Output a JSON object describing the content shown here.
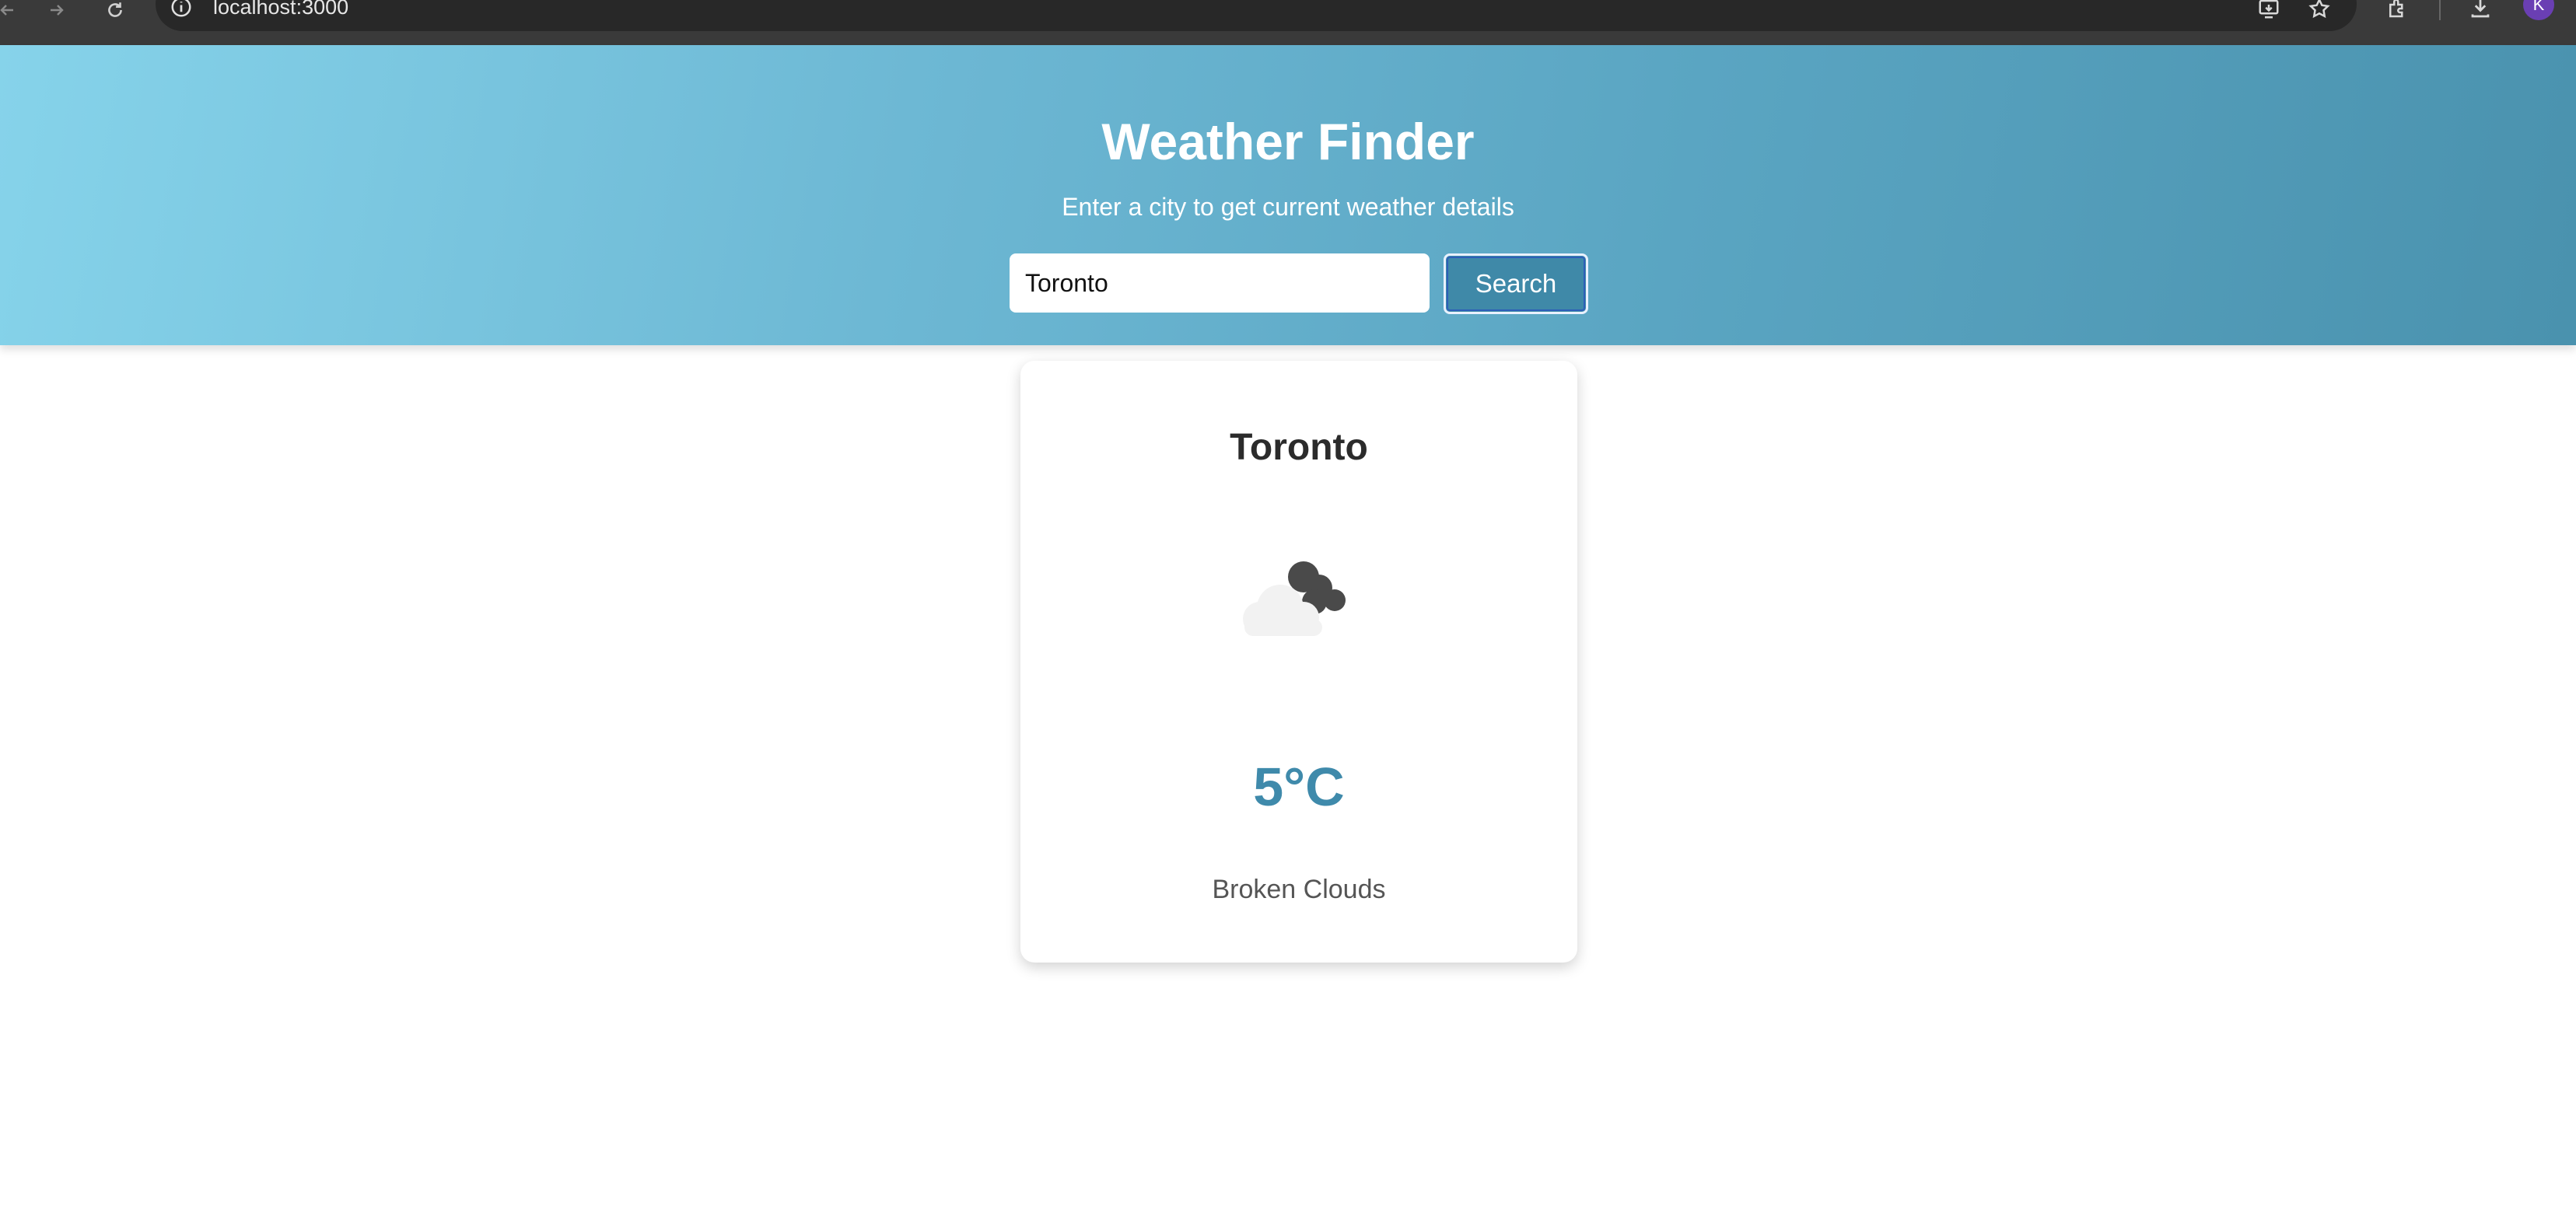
{
  "browser": {
    "url": "localhost:3000",
    "avatar_initial": "K",
    "icons": [
      "back-arrow-icon",
      "forward-arrow-icon",
      "reload-icon",
      "info-icon",
      "install-app-icon",
      "star-icon",
      "extensions-icon",
      "download-icon"
    ]
  },
  "header": {
    "title": "Weather Finder",
    "subtitle": "Enter a city to get current weather details",
    "search": {
      "value": "Toronto",
      "placeholder": "",
      "button_label": "Search"
    }
  },
  "weather": {
    "city": "Toronto",
    "icon": "broken-clouds-icon",
    "temperature": "5°C",
    "description": "Broken Clouds"
  },
  "colors": {
    "header_gradient_start": "#86d3ea",
    "header_gradient_end": "#4a92ae",
    "button_bg": "#3f89a8",
    "temperature_text": "#3f8aab"
  }
}
